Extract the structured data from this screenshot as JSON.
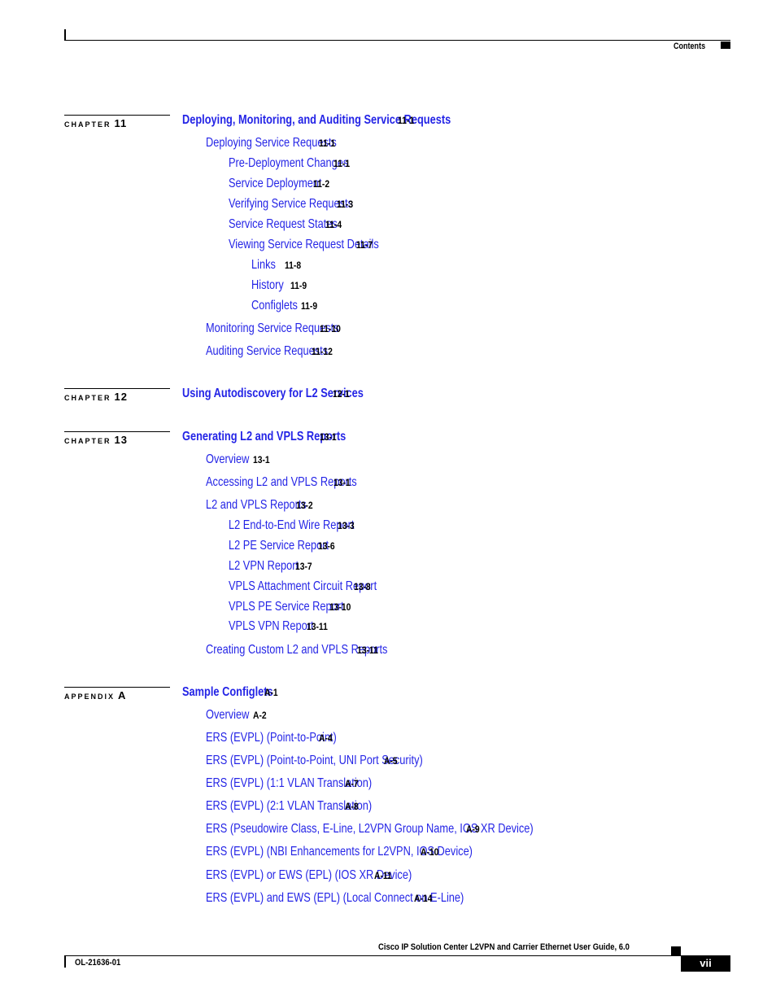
{
  "header": {
    "section_label": "Contents"
  },
  "sections": [
    {
      "kind": "CHAPTER",
      "number": "11",
      "title": "Deploying, Monitoring, and Auditing Service Requests",
      "page": "11-1",
      "entries": [
        {
          "level": 1,
          "title": "Deploying Service Requests",
          "page": "11-1"
        },
        {
          "level": 2,
          "title": "Pre-Deployment Changes",
          "page": "11-1"
        },
        {
          "level": 2,
          "title": "Service Deployment",
          "page": "11-2"
        },
        {
          "level": 2,
          "title": "Verifying Service Requests",
          "page": "11-3"
        },
        {
          "level": 2,
          "title": "Service Request States",
          "page": "11-4"
        },
        {
          "level": 2,
          "title": "Viewing Service Request Details",
          "page": "11-7"
        },
        {
          "level": 3,
          "title": "Links",
          "page": "11-8"
        },
        {
          "level": 3,
          "title": "History",
          "page": "11-9"
        },
        {
          "level": 3,
          "title": "Configlets",
          "page": "11-9"
        },
        {
          "level": 1,
          "title": "Monitoring Service Requests",
          "page": "11-10"
        },
        {
          "level": 1,
          "title": "Auditing Service Requests",
          "page": "11-12"
        }
      ]
    },
    {
      "kind": "CHAPTER",
      "number": "12",
      "title": "Using Autodiscovery for L2 Services",
      "page": "12-1",
      "entries": []
    },
    {
      "kind": "CHAPTER",
      "number": "13",
      "title": "Generating L2 and VPLS Reports",
      "page": "13-1",
      "entries": [
        {
          "level": 1,
          "title": "Overview",
          "page": "13-1"
        },
        {
          "level": 1,
          "title": "Accessing L2 and VPLS Reports",
          "page": "13-1"
        },
        {
          "level": 1,
          "title": "L2 and VPLS Reports",
          "page": "13-2"
        },
        {
          "level": 2,
          "title": "L2 End-to-End Wire Report",
          "page": "13-3"
        },
        {
          "level": 2,
          "title": "L2 PE Service Report",
          "page": "13-6"
        },
        {
          "level": 2,
          "title": "L2 VPN Report",
          "page": "13-7"
        },
        {
          "level": 2,
          "title": "VPLS Attachment Circuit Report",
          "page": "13-8"
        },
        {
          "level": 2,
          "title": "VPLS PE Service Report",
          "page": "13-10"
        },
        {
          "level": 2,
          "title": "VPLS VPN Report",
          "page": "13-11"
        },
        {
          "level": 1,
          "title": "Creating Custom L2 and VPLS Reports",
          "page": "13-11"
        }
      ]
    },
    {
      "kind": "APPENDIX",
      "number": "A",
      "title": "Sample Configlets",
      "page": "A-1",
      "entries": [
        {
          "level": 1,
          "title": "Overview",
          "page": "A-2"
        },
        {
          "level": 1,
          "title": "ERS (EVPL) (Point-to-Point)",
          "page": "A-4"
        },
        {
          "level": 1,
          "title": "ERS (EVPL) (Point-to-Point, UNI Port Security)",
          "page": "A-5"
        },
        {
          "level": 1,
          "title": "ERS (EVPL) (1:1 VLAN Translation)",
          "page": "A-7"
        },
        {
          "level": 1,
          "title": "ERS (EVPL) (2:1 VLAN Translation)",
          "page": "A-8"
        },
        {
          "level": 1,
          "title": "ERS (Pseudowire Class, E-Line, L2VPN Group Name, IOS XR Device)",
          "page": "A-9"
        },
        {
          "level": 1,
          "title": "ERS (EVPL) (NBI Enhancements for L2VPN, IOS Device)",
          "page": "A-10"
        },
        {
          "level": 1,
          "title": "ERS (EVPL) or EWS (EPL) (IOS XR Device)",
          "page": "A-11"
        },
        {
          "level": 1,
          "title": "ERS (EVPL) and EWS (EPL) (Local Connect on E-Line)",
          "page": "A-14"
        }
      ]
    }
  ],
  "footer": {
    "book_title": "Cisco IP Solution Center L2VPN and Carrier Ethernet User Guide, 6.0",
    "doc_number": "OL-21636-01",
    "page_number": "vii"
  }
}
